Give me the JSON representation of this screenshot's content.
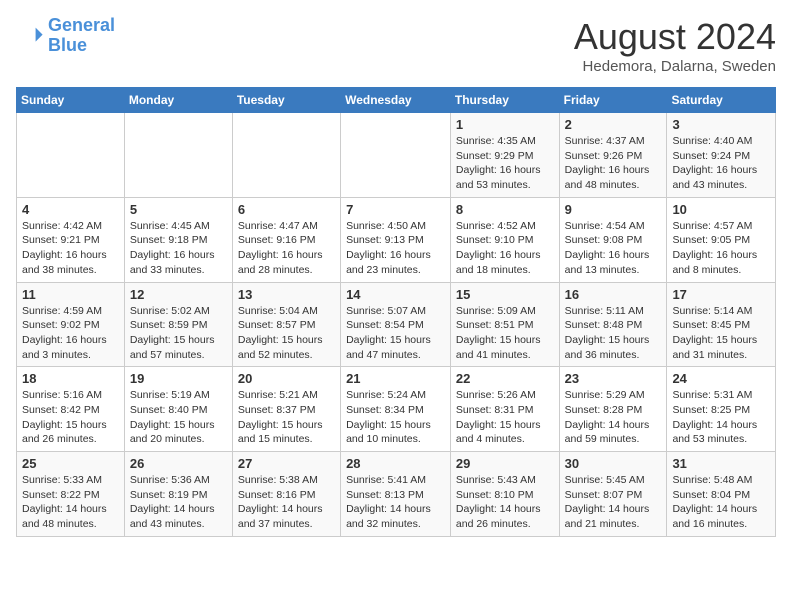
{
  "logo": {
    "line1": "General",
    "line2": "Blue"
  },
  "title": "August 2024",
  "location": "Hedemora, Dalarna, Sweden",
  "days_of_week": [
    "Sunday",
    "Monday",
    "Tuesday",
    "Wednesday",
    "Thursday",
    "Friday",
    "Saturday"
  ],
  "weeks": [
    [
      {
        "day": "",
        "info": ""
      },
      {
        "day": "",
        "info": ""
      },
      {
        "day": "",
        "info": ""
      },
      {
        "day": "",
        "info": ""
      },
      {
        "day": "1",
        "info": "Sunrise: 4:35 AM\nSunset: 9:29 PM\nDaylight: 16 hours\nand 53 minutes."
      },
      {
        "day": "2",
        "info": "Sunrise: 4:37 AM\nSunset: 9:26 PM\nDaylight: 16 hours\nand 48 minutes."
      },
      {
        "day": "3",
        "info": "Sunrise: 4:40 AM\nSunset: 9:24 PM\nDaylight: 16 hours\nand 43 minutes."
      }
    ],
    [
      {
        "day": "4",
        "info": "Sunrise: 4:42 AM\nSunset: 9:21 PM\nDaylight: 16 hours\nand 38 minutes."
      },
      {
        "day": "5",
        "info": "Sunrise: 4:45 AM\nSunset: 9:18 PM\nDaylight: 16 hours\nand 33 minutes."
      },
      {
        "day": "6",
        "info": "Sunrise: 4:47 AM\nSunset: 9:16 PM\nDaylight: 16 hours\nand 28 minutes."
      },
      {
        "day": "7",
        "info": "Sunrise: 4:50 AM\nSunset: 9:13 PM\nDaylight: 16 hours\nand 23 minutes."
      },
      {
        "day": "8",
        "info": "Sunrise: 4:52 AM\nSunset: 9:10 PM\nDaylight: 16 hours\nand 18 minutes."
      },
      {
        "day": "9",
        "info": "Sunrise: 4:54 AM\nSunset: 9:08 PM\nDaylight: 16 hours\nand 13 minutes."
      },
      {
        "day": "10",
        "info": "Sunrise: 4:57 AM\nSunset: 9:05 PM\nDaylight: 16 hours\nand 8 minutes."
      }
    ],
    [
      {
        "day": "11",
        "info": "Sunrise: 4:59 AM\nSunset: 9:02 PM\nDaylight: 16 hours\nand 3 minutes."
      },
      {
        "day": "12",
        "info": "Sunrise: 5:02 AM\nSunset: 8:59 PM\nDaylight: 15 hours\nand 57 minutes."
      },
      {
        "day": "13",
        "info": "Sunrise: 5:04 AM\nSunset: 8:57 PM\nDaylight: 15 hours\nand 52 minutes."
      },
      {
        "day": "14",
        "info": "Sunrise: 5:07 AM\nSunset: 8:54 PM\nDaylight: 15 hours\nand 47 minutes."
      },
      {
        "day": "15",
        "info": "Sunrise: 5:09 AM\nSunset: 8:51 PM\nDaylight: 15 hours\nand 41 minutes."
      },
      {
        "day": "16",
        "info": "Sunrise: 5:11 AM\nSunset: 8:48 PM\nDaylight: 15 hours\nand 36 minutes."
      },
      {
        "day": "17",
        "info": "Sunrise: 5:14 AM\nSunset: 8:45 PM\nDaylight: 15 hours\nand 31 minutes."
      }
    ],
    [
      {
        "day": "18",
        "info": "Sunrise: 5:16 AM\nSunset: 8:42 PM\nDaylight: 15 hours\nand 26 minutes."
      },
      {
        "day": "19",
        "info": "Sunrise: 5:19 AM\nSunset: 8:40 PM\nDaylight: 15 hours\nand 20 minutes."
      },
      {
        "day": "20",
        "info": "Sunrise: 5:21 AM\nSunset: 8:37 PM\nDaylight: 15 hours\nand 15 minutes."
      },
      {
        "day": "21",
        "info": "Sunrise: 5:24 AM\nSunset: 8:34 PM\nDaylight: 15 hours\nand 10 minutes."
      },
      {
        "day": "22",
        "info": "Sunrise: 5:26 AM\nSunset: 8:31 PM\nDaylight: 15 hours\nand 4 minutes."
      },
      {
        "day": "23",
        "info": "Sunrise: 5:29 AM\nSunset: 8:28 PM\nDaylight: 14 hours\nand 59 minutes."
      },
      {
        "day": "24",
        "info": "Sunrise: 5:31 AM\nSunset: 8:25 PM\nDaylight: 14 hours\nand 53 minutes."
      }
    ],
    [
      {
        "day": "25",
        "info": "Sunrise: 5:33 AM\nSunset: 8:22 PM\nDaylight: 14 hours\nand 48 minutes."
      },
      {
        "day": "26",
        "info": "Sunrise: 5:36 AM\nSunset: 8:19 PM\nDaylight: 14 hours\nand 43 minutes."
      },
      {
        "day": "27",
        "info": "Sunrise: 5:38 AM\nSunset: 8:16 PM\nDaylight: 14 hours\nand 37 minutes."
      },
      {
        "day": "28",
        "info": "Sunrise: 5:41 AM\nSunset: 8:13 PM\nDaylight: 14 hours\nand 32 minutes."
      },
      {
        "day": "29",
        "info": "Sunrise: 5:43 AM\nSunset: 8:10 PM\nDaylight: 14 hours\nand 26 minutes."
      },
      {
        "day": "30",
        "info": "Sunrise: 5:45 AM\nSunset: 8:07 PM\nDaylight: 14 hours\nand 21 minutes."
      },
      {
        "day": "31",
        "info": "Sunrise: 5:48 AM\nSunset: 8:04 PM\nDaylight: 14 hours\nand 16 minutes."
      }
    ]
  ]
}
